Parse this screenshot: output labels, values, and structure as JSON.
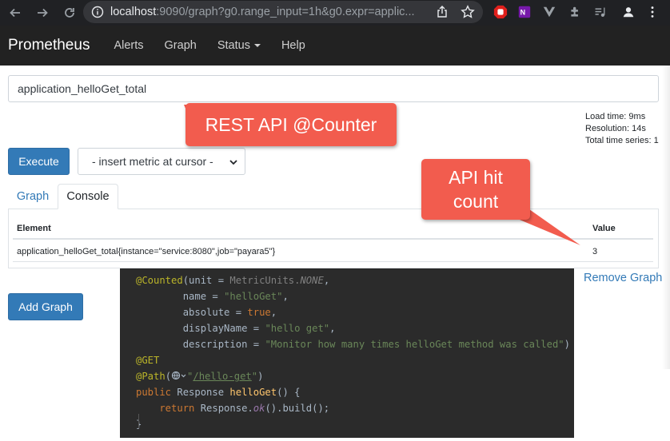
{
  "browser": {
    "url_host": "localhost",
    "url_rest": ":9090/graph?g0.range_input=1h&g0.expr=applic..."
  },
  "navbar": {
    "brand": "Prometheus",
    "links": [
      "Alerts",
      "Graph",
      "Status",
      "Help"
    ]
  },
  "query": {
    "expression": "application_helloGet_total"
  },
  "stats": {
    "load_time": "Load time: 9ms",
    "resolution": "Resolution: 14s",
    "total_series": "Total time series: 1"
  },
  "controls": {
    "execute_label": "Execute",
    "metric_select": "- insert metric at cursor -",
    "add_graph_label": "Add Graph",
    "remove_graph_label": "Remove Graph"
  },
  "tabs": [
    "Graph",
    "Console"
  ],
  "table": {
    "headers": [
      "Element",
      "Value"
    ],
    "rows": [
      {
        "element": "application_helloGet_total{instance=\"service:8080\",job=\"payara5\"}",
        "value": "3"
      }
    ]
  },
  "callouts": {
    "rest_api": "REST API @Counter",
    "hit_line1": "API hit",
    "hit_line2": "count"
  },
  "code": {
    "l1_ann": "@Counted",
    "l1_open": "(unit = ",
    "l1_cls": "MetricUnits.",
    "l1_const": "NONE",
    "l1_end": ",",
    "l2_key": "        name = ",
    "l2_val": "\"helloGet\"",
    "l2_end": ",",
    "l3_key": "        absolute = ",
    "l3_val": "true",
    "l3_end": ",",
    "l4_key": "        displayName = ",
    "l4_val": "\"hello get\"",
    "l4_end": ",",
    "l5_key": "        description = ",
    "l5_val": "\"Monitor how many times helloGet method was called\"",
    "l5_end": ")",
    "l6_ann": "@GET",
    "l7_ann": "@Path",
    "l7_open": "(",
    "l7_q1": "\"",
    "l7_path": "/hello-get",
    "l7_q2": "\"",
    "l7_end": ")",
    "l8_kw": "public",
    "l8_type": " Response ",
    "l8_fn": "helloGet",
    "l8_end": "() {",
    "l9_kw": "    return",
    "l9_mid": " Response.",
    "l9_ok": "ok",
    "l9_end": "().build();",
    "l10": "}"
  },
  "colors": {
    "navbar_bg": "#222222",
    "primary": "#337ab7",
    "callout": "#f25c4e",
    "code_bg": "#2b2b2b"
  }
}
